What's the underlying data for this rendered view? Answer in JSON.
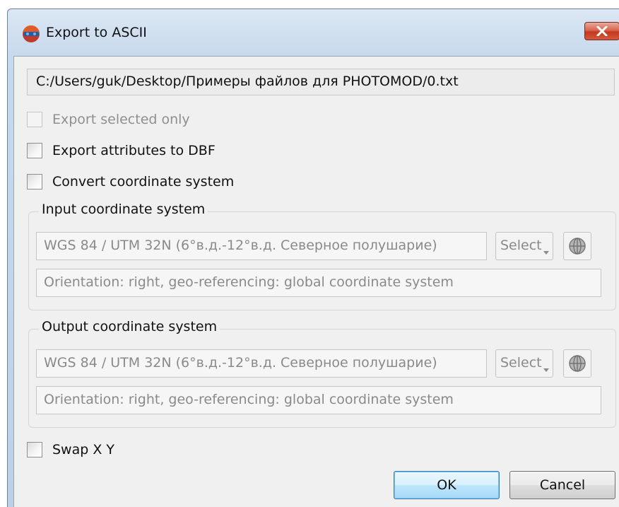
{
  "window": {
    "title": "Export to ASCII",
    "app_icon": "photomod-icon",
    "close_icon": "close-icon"
  },
  "file_path": "C:/Users/guk/Desktop/Примеры файлов для PHOTOMOD/0.txt",
  "options": {
    "export_selected_only": {
      "label": "Export selected only",
      "checked": false,
      "enabled": false
    },
    "export_attributes_dbf": {
      "label": "Export attributes to DBF",
      "checked": false,
      "enabled": true
    },
    "convert_coordinate_system": {
      "label": "Convert coordinate system",
      "checked": false,
      "enabled": true
    },
    "swap_xy": {
      "label": "Swap X Y",
      "checked": false,
      "enabled": true
    }
  },
  "input_cs": {
    "group_title": "Input coordinate system",
    "value": "WGS 84 / UTM 32N (6°в.д.-12°в.д. Северное полушарие)",
    "select_label": "Select",
    "info": "Orientation: right, geo-referencing: global coordinate system",
    "globe_icon": "globe-icon"
  },
  "output_cs": {
    "group_title": "Output coordinate system",
    "value": "WGS 84 / UTM 32N (6°в.д.-12°в.д. Северное полушарие)",
    "select_label": "Select",
    "info": "Orientation: right, geo-referencing: global coordinate system",
    "globe_icon": "globe-icon"
  },
  "buttons": {
    "ok": "OK",
    "cancel": "Cancel"
  },
  "colors": {
    "title_bar": "#c7d9ec",
    "close_button": "#c3381e",
    "ok_border": "#3c7fb1",
    "disabled_text": "#8a8a8a"
  }
}
